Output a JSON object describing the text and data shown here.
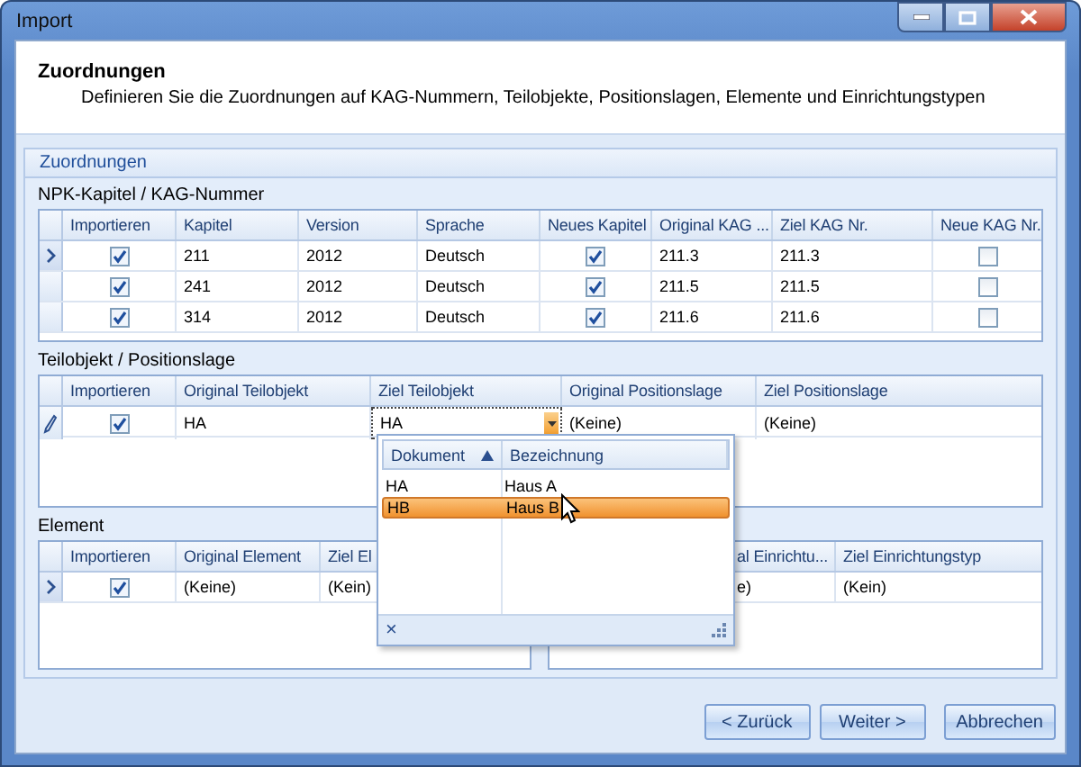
{
  "window": {
    "title": "Import"
  },
  "header": {
    "title": "Zuordnungen",
    "subtitle": "Definieren Sie die Zuordnungen auf KAG-Nummern, Teilobjekte, Positionslagen, Elemente und Einrichtungstypen"
  },
  "group": {
    "title": "Zuordnungen"
  },
  "npk": {
    "title": "NPK-Kapitel / KAG-Nummer",
    "columns": [
      "Importieren",
      "Kapitel",
      "Version",
      "Sprache",
      "Neues Kapitel",
      "Original KAG ...",
      "Ziel KAG Nr.",
      "Neue KAG Nr."
    ],
    "rows": [
      {
        "current": true,
        "editing": false,
        "cells": [
          {
            "kind": "check",
            "checked": true
          },
          {
            "kind": "text",
            "text": "211"
          },
          {
            "kind": "text",
            "text": "2012"
          },
          {
            "kind": "text",
            "text": "Deutsch"
          },
          {
            "kind": "check",
            "checked": true
          },
          {
            "kind": "text",
            "text": "211.3"
          },
          {
            "kind": "text",
            "text": "211.3"
          },
          {
            "kind": "check",
            "checked": false
          }
        ]
      },
      {
        "current": false,
        "editing": false,
        "cells": [
          {
            "kind": "check",
            "checked": true
          },
          {
            "kind": "text",
            "text": "241"
          },
          {
            "kind": "text",
            "text": "2012"
          },
          {
            "kind": "text",
            "text": "Deutsch"
          },
          {
            "kind": "check",
            "checked": true
          },
          {
            "kind": "text",
            "text": "211.5"
          },
          {
            "kind": "text",
            "text": "211.5"
          },
          {
            "kind": "check",
            "checked": false
          }
        ]
      },
      {
        "current": false,
        "editing": false,
        "cells": [
          {
            "kind": "check",
            "checked": true
          },
          {
            "kind": "text",
            "text": "314"
          },
          {
            "kind": "text",
            "text": "2012"
          },
          {
            "kind": "text",
            "text": "Deutsch"
          },
          {
            "kind": "check",
            "checked": true
          },
          {
            "kind": "text",
            "text": "211.6"
          },
          {
            "kind": "text",
            "text": "211.6"
          },
          {
            "kind": "check",
            "checked": false
          }
        ]
      }
    ]
  },
  "teilobjekt": {
    "title": "Teilobjekt / Positionslage",
    "columns": [
      "Importieren",
      "Original Teilobjekt",
      "Ziel Teilobjekt",
      "Original Positionslage",
      "Ziel Positionslage"
    ],
    "rows": [
      {
        "current": false,
        "editing": true,
        "cells": [
          {
            "kind": "check",
            "checked": true
          },
          {
            "kind": "text",
            "text": "HA"
          },
          {
            "kind": "combo",
            "text": "HA"
          },
          {
            "kind": "text",
            "text": "(Keine)"
          },
          {
            "kind": "text",
            "text": "(Keine)"
          }
        ]
      }
    ]
  },
  "element": {
    "title": "Element",
    "columns": [
      "Importieren",
      "Original Element",
      "Ziel El"
    ],
    "rows": [
      {
        "current": true,
        "editing": false,
        "cells": [
          {
            "kind": "check",
            "checked": true
          },
          {
            "kind": "text",
            "text": "(Keine)"
          },
          {
            "kind": "text",
            "text": "(Kein)"
          }
        ]
      }
    ]
  },
  "einrichtung": {
    "columns": [
      "al Einrichtu...",
      "Ziel Einrichtungstyp"
    ],
    "rows": [
      {
        "cells": [
          {
            "kind": "text",
            "text": "e)"
          },
          {
            "kind": "text",
            "text": "(Kein)"
          }
        ]
      }
    ]
  },
  "dropdown": {
    "columns": [
      {
        "label": "Dokument",
        "sorted_ascending": true
      },
      {
        "label": "Bezeichnung",
        "sorted_ascending": false
      }
    ],
    "rows": [
      {
        "dokument": "HA",
        "bezeichnung": "Haus A",
        "selected": false
      },
      {
        "dokument": "HB",
        "bezeichnung": "Haus B",
        "selected": true
      }
    ],
    "footer": {
      "close": "×"
    }
  },
  "buttons": [
    "< Zurück",
    "Weiter >",
    "Abbrechen"
  ]
}
